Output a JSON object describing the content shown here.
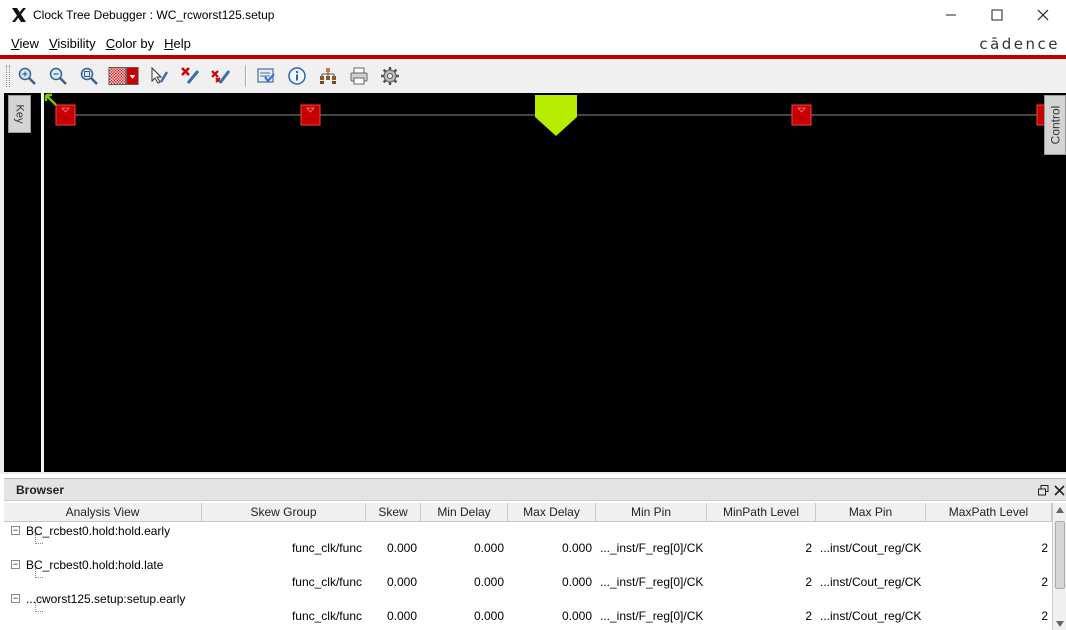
{
  "window": {
    "title": "Clock Tree Debugger : WC_rcworst125.setup",
    "minimize_icon": "minimize-icon",
    "maximize_icon": "maximize-icon",
    "close_icon": "close-icon"
  },
  "menubar": {
    "items": [
      {
        "label": "View"
      },
      {
        "label": "Visibility"
      },
      {
        "label": "Color by"
      },
      {
        "label": "Help"
      }
    ],
    "brand": "cādence"
  },
  "toolbar": {
    "icons": [
      "zoom-in-icon",
      "zoom-out-icon",
      "zoom-fit-icon",
      "pattern-select-icon",
      "select-pointer-icon",
      "delete-icon",
      "delete-all-icon",
      "report-icon",
      "info-icon",
      "hierarchy-icon",
      "print-icon",
      "settings-icon"
    ]
  },
  "canvas": {
    "key_tab": "Key",
    "control_tab": "Control",
    "colors": {
      "background": "#000000",
      "node": "#c40000",
      "root": "#b5ee00",
      "wire": "#888888"
    }
  },
  "browser": {
    "title": "Browser",
    "columns": [
      "Analysis View",
      "Skew Group",
      "Skew",
      "Min Delay",
      "Max Delay",
      "Min Pin",
      "MinPath Level",
      "Max Pin",
      "MaxPath Level"
    ],
    "groups": [
      {
        "name": "BC_rcbest0.hold:hold.early",
        "row": {
          "skew_group": "func_clk/func",
          "skew": "0.000",
          "min_delay": "0.000",
          "max_delay": "0.000",
          "min_pin": "..._inst/F_reg[0]/CK",
          "min_level": "2",
          "max_pin": "...inst/Cout_reg/CK",
          "max_level": "2"
        }
      },
      {
        "name": "BC_rcbest0.hold:hold.late",
        "row": {
          "skew_group": "func_clk/func",
          "skew": "0.000",
          "min_delay": "0.000",
          "max_delay": "0.000",
          "min_pin": "..._inst/F_reg[0]/CK",
          "min_level": "2",
          "max_pin": "...inst/Cout_reg/CK",
          "max_level": "2"
        }
      },
      {
        "name": "...cworst125.setup:setup.early",
        "row": {
          "skew_group": "func_clk/func",
          "skew": "0.000",
          "min_delay": "0.000",
          "max_delay": "0.000",
          "min_pin": "..._inst/F_reg[0]/CK",
          "min_level": "2",
          "max_pin": "...inst/Cout_reg/CK",
          "max_level": "2"
        }
      }
    ]
  }
}
